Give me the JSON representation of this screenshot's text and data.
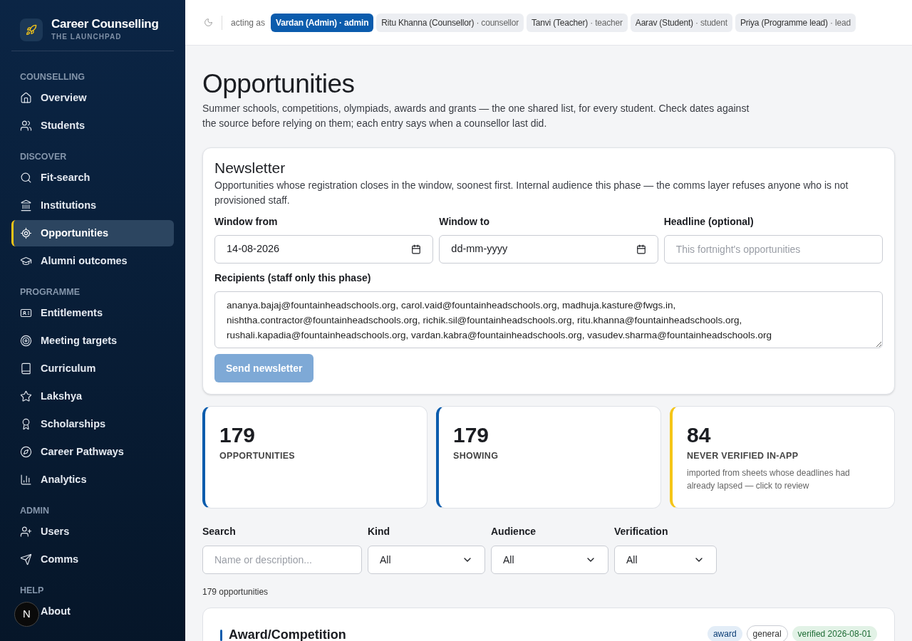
{
  "brand": {
    "title": "Career Counselling",
    "subtitle": "THE LAUNCHPAD"
  },
  "sidebar": {
    "sections": [
      {
        "label": "COUNSELLING",
        "items": [
          {
            "label": "Overview",
            "selected": false
          },
          {
            "label": "Students",
            "selected": false
          }
        ]
      },
      {
        "label": "DISCOVER",
        "items": [
          {
            "label": "Fit-search",
            "selected": false
          },
          {
            "label": "Institutions",
            "selected": false
          },
          {
            "label": "Opportunities",
            "selected": true
          },
          {
            "label": "Alumni outcomes",
            "selected": false
          }
        ]
      },
      {
        "label": "PROGRAMME",
        "items": [
          {
            "label": "Entitlements",
            "selected": false
          },
          {
            "label": "Meeting targets",
            "selected": false
          },
          {
            "label": "Curriculum",
            "selected": false
          },
          {
            "label": "Lakshya",
            "selected": false
          },
          {
            "label": "Scholarships",
            "selected": false
          },
          {
            "label": "Career Pathways",
            "selected": false
          },
          {
            "label": "Analytics",
            "selected": false
          }
        ]
      },
      {
        "label": "ADMIN",
        "items": [
          {
            "label": "Users",
            "selected": false
          },
          {
            "label": "Comms",
            "selected": false
          }
        ]
      },
      {
        "label": "HELP",
        "items": [
          {
            "label": "About",
            "selected": false
          }
        ]
      }
    ]
  },
  "dev_badge": "N",
  "topbar": {
    "acting_as": "acting as",
    "separator": "·",
    "roles": [
      {
        "name": "Vardan (Admin)",
        "role": "admin",
        "selected": true
      },
      {
        "name": "Ritu Khanna (Counsellor)",
        "role": "counsellor",
        "selected": false
      },
      {
        "name": "Tanvi (Teacher)",
        "role": "teacher",
        "selected": false
      },
      {
        "name": "Aarav (Student)",
        "role": "student",
        "selected": false
      },
      {
        "name": "Priya (Programme lead)",
        "role": "lead",
        "selected": false
      }
    ]
  },
  "page": {
    "title": "Opportunities",
    "description": "Summer schools, competitions, olympiads, awards and grants — the one shared list, for every student. Check dates against the source before relying on them; each entry says when a counsellor last did."
  },
  "newsletter": {
    "title": "Newsletter",
    "description": "Opportunities whose registration closes in the window, soonest first. Internal audience this phase — the comms layer refuses anyone who is not provisioned staff.",
    "window_from": {
      "label": "Window from",
      "value": "14-08-2026"
    },
    "window_to": {
      "label": "Window to",
      "placeholder": "dd-mm-yyyy"
    },
    "headline": {
      "label": "Headline (optional)",
      "placeholder": "This fortnight's opportunities"
    },
    "recipients": {
      "label": "Recipients (staff only this phase)",
      "value": "ananya.bajaj@fountainheadschools.org, carol.vaid@fountainheadschools.org, madhuja.kasture@fwgs.in, nishtha.contractor@fountainheadschools.org, richik.sil@fountainheadschools.org, ritu.khanna@fountainheadschools.org, rushali.kapadia@fountainheadschools.org, vardan.kabra@fountainheadschools.org, vasudev.sharma@fountainheadschools.org"
    },
    "send_button": {
      "label": "Send newsletter",
      "disabled": true
    }
  },
  "stats": [
    {
      "value": "179",
      "label": "OPPORTUNITIES",
      "color": "#0b5cad"
    },
    {
      "value": "179",
      "label": "SHOWING",
      "color": "#0b5cad"
    },
    {
      "value": "84",
      "label": "NEVER VERIFIED IN-APP",
      "note": "imported from sheets whose deadlines had already lapsed — click to review",
      "color": "#f5c518"
    }
  ],
  "filters": {
    "search": {
      "label": "Search",
      "placeholder": "Name or description..."
    },
    "selects": [
      {
        "label": "Kind",
        "value": "All"
      },
      {
        "label": "Audience",
        "value": "All"
      },
      {
        "label": "Verification",
        "value": "All"
      }
    ]
  },
  "result_count": "179 opportunities",
  "entry": {
    "title": "Award/Competition",
    "tags": [
      {
        "label": "award",
        "kind": "type"
      },
      {
        "label": "general",
        "kind": "audience"
      },
      {
        "label": "verified 2026-08-01",
        "kind": "verified"
      }
    ]
  }
}
